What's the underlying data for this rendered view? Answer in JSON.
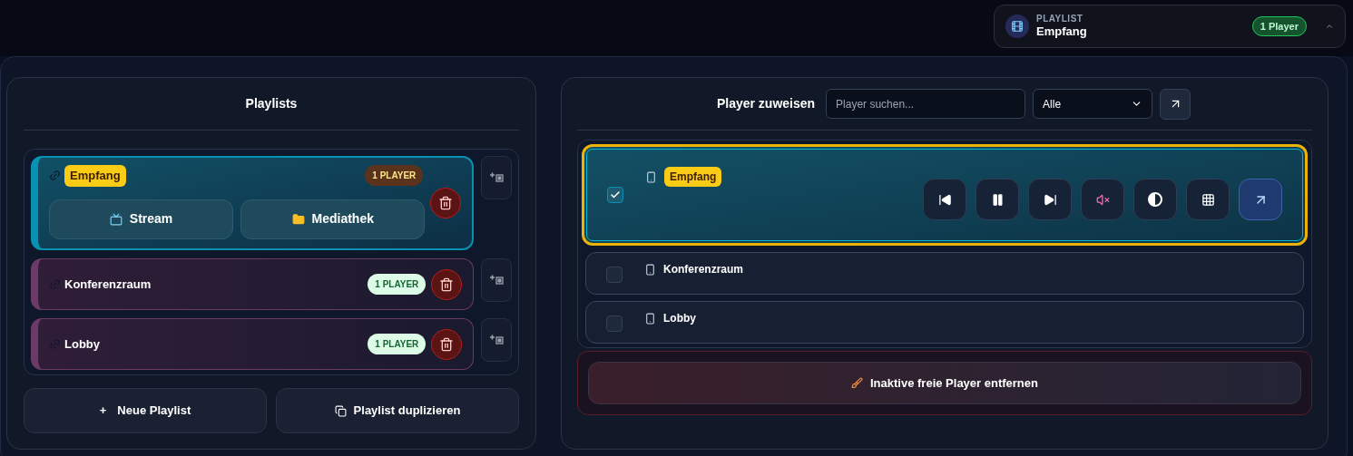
{
  "header": {
    "label": "PLAYLIST",
    "name": "Empfang",
    "badge": "1 Player",
    "expanded": false
  },
  "playlists_panel": {
    "title": "Playlists",
    "playlists": [
      {
        "name": "Empfang",
        "badge": "1 PLAYER",
        "selected": true,
        "actions": [
          "Stream",
          "Mediathek"
        ]
      },
      {
        "name": "Konferenzraum",
        "badge": "1 PLAYER",
        "selected": false
      },
      {
        "name": "Lobby",
        "badge": "1 PLAYER",
        "selected": false
      }
    ],
    "buttons": [
      {
        "kind": "add",
        "icon": "+",
        "label": "Neue Playlist"
      },
      {
        "kind": "duplicate",
        "label": "Playlist duplizieren"
      }
    ]
  },
  "players_panel": {
    "title": "Player zuweisen",
    "search": {
      "placeholder": "Player suchen..."
    },
    "filter": "Alle",
    "players": [
      {
        "name": "Empfang",
        "checked": true,
        "selected": true
      },
      {
        "name": "Konferenzraum",
        "checked": false,
        "selected": false
      },
      {
        "name": "Lobby",
        "checked": false,
        "selected": false
      }
    ],
    "cleanup_button": "Inaktive freie Player entfernen"
  }
}
